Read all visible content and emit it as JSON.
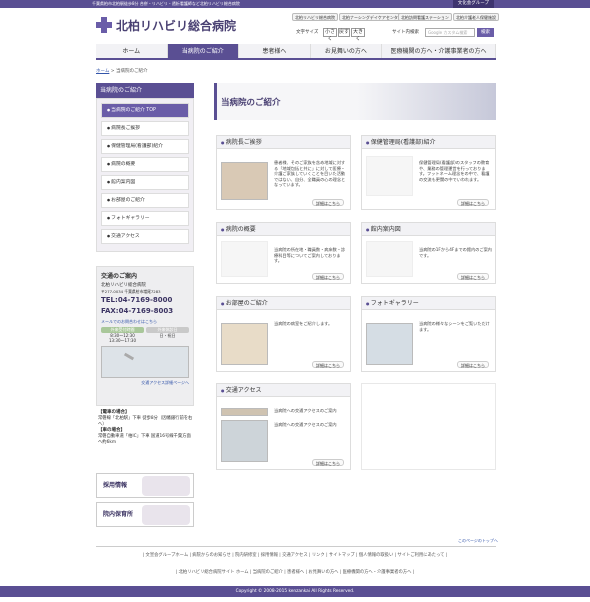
{
  "header": {
    "top_text": "千葉県柏市北柏駅徒歩8分 合併・リハビリ・透析看護師など北柏リハビリ総合病院",
    "group_link": "文化会グループ",
    "logo_text": "北柏リハビリ総合病院",
    "quick_links": [
      "北柏リハビリ総合病院",
      "北柏ナーシングデイケアセンター",
      "北柏訪問看護ステーション",
      "北柏介護老人保健施設"
    ],
    "font_size_label": "文字サイズ",
    "font_sizes": [
      "小さく",
      "戻す",
      "大きく"
    ],
    "site_search_label": "サイト内検索",
    "search_placeholder": "Google カスタム検索",
    "search_button": "検索"
  },
  "nav": {
    "items": [
      "ホーム",
      "当病院のご紹介",
      "患者様へ",
      "お見舞いの方へ",
      "医療機関の方へ・介護事業者の方へ"
    ]
  },
  "breadcrumb": {
    "home": "ホーム",
    "current": "当病院のご紹介"
  },
  "sidebar": {
    "title": "当病院のご紹介",
    "items": [
      "当病院のご紹介 TOP",
      "病院長ご挨拶",
      "保健管理局(看護部)紹介",
      "病院の概要",
      "館内案内図",
      "お部屋のご紹介",
      "フォトギャラリー",
      "交通アクセス"
    ]
  },
  "access": {
    "title": "交通のご案内",
    "name": "北柏リハビリ総合病院",
    "address": "〒277-0034 千葉県柏市増尾7283",
    "tel": "TEL:04-7169-8000",
    "fax": "FAX:04-7169-8003",
    "mail": "メールでのお問合わせはこちら",
    "hours": [
      {
        "label": "外来受付時間",
        "value": "8:30〜12:30\n13:30〜17:30"
      },
      {
        "label": "外来休診日",
        "value": "日・祝日"
      }
    ],
    "map_link": "交通アクセス詳細ページへ",
    "route": [
      {
        "head": "【電車の場合】",
        "text": "常磐線「北柏駅」下車 徒歩8分（因幡銀行前を右へ）"
      },
      {
        "head": "【車の場合】",
        "text": "常磐自動車道「柏IC」下車 国道16号線千葉方面へ約6km"
      }
    ]
  },
  "banners": [
    "採用情報",
    "院内保育所"
  ],
  "main": {
    "title": "当病院のご紹介",
    "more": "詳細はこちら",
    "boxes": [
      {
        "title": "病院長ご挨拶",
        "text": "患者様、そのご家族を含め地域に対する「地域包括と共に」に対して医療・介護ご家族していくことを目いた活動ではない、自分、全職員の心の理念となっています。"
      },
      {
        "title": "保健管理局(看護部)紹介",
        "text": "保健管理局(看護部)のスタッフの教育や、業務の管理運営を行っております。フットネーム理念をの中で、看護の交流も更関の中でいわれます。"
      },
      {
        "title": "病院の概要",
        "text": "当病院の所在地・職員数・病床数・診療科目等についてご案内しております。"
      },
      {
        "title": "館内案内図",
        "text": "当病院の1Fから4Fまでの館内のご案内です。"
      },
      {
        "title": "お部屋のご紹介",
        "text": "当病院の病室をご紹介します。"
      },
      {
        "title": "フォトギャラリー",
        "text": "当病院の様々なシーンをご覧いただけます。"
      },
      {
        "title": "交通アクセス",
        "text": "当病院への交通アクセスのご案内"
      }
    ]
  },
  "footer": {
    "pagetop": "このページのトップへ",
    "links1": "| 文宣会グループホーム | 病院からのお知らせ | 院内研修室 | 採用情報 | 交通アクセス | リンク | サイトマップ | 個人情報の取扱い | サイトご利用にあたって |",
    "links2": "| 北柏リハビリ総合病院サイト ホーム | 当病院のご紹介 | 患者様へ | お見舞いの方へ | 医療機関の方へ・介護事業者の方へ |",
    "copyright": "Copyright © 2008-2015 kenzankai All Rights Reserved."
  }
}
